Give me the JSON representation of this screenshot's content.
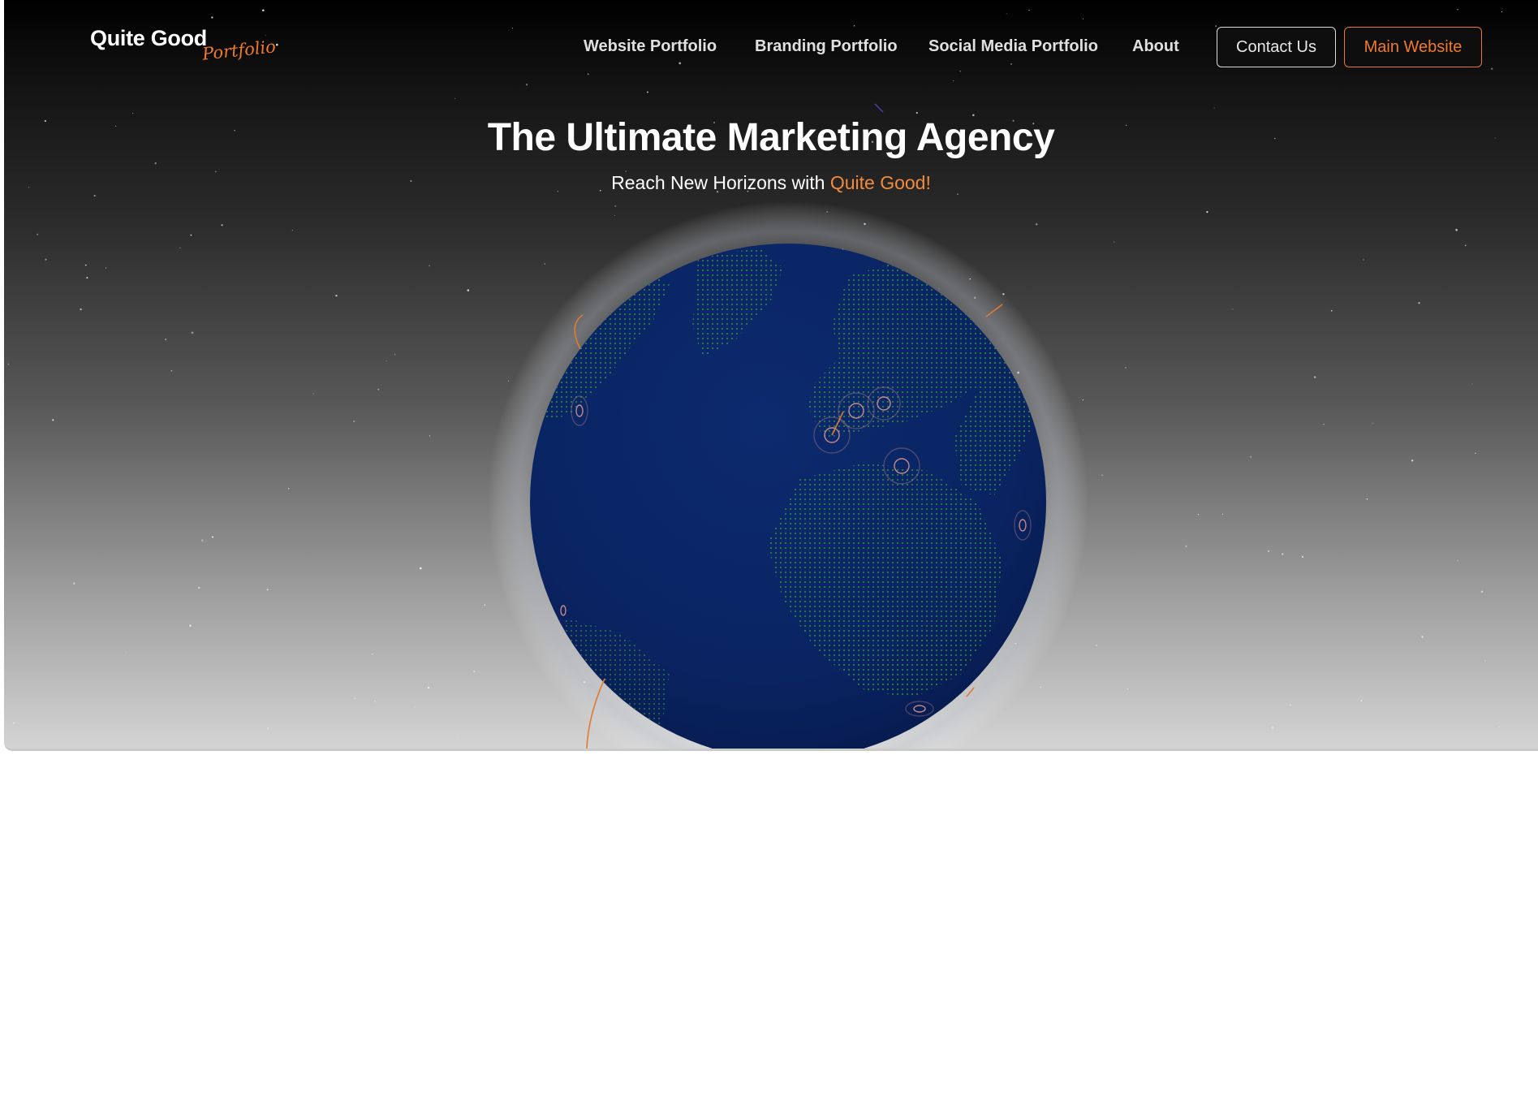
{
  "brand": {
    "name": "Quite Good",
    "tagline": "Portfolio",
    "accent_color": "#f07a2a"
  },
  "nav": {
    "links": [
      {
        "label": "Website Portfolio"
      },
      {
        "label": "Branding Portfolio"
      },
      {
        "label": "Social Media Portfolio"
      },
      {
        "label": "About"
      }
    ],
    "contact_label": "Contact Us",
    "main_website_label": "Main Website"
  },
  "hero": {
    "title": "The Ultimate Marketing Agency",
    "subtitle_prefix": "Reach New Horizons with ",
    "subtitle_accent": "Quite Good!",
    "globe_color": "#0a2564",
    "land_dot_color": "#2e8b3a",
    "arc_color": "#e07a32"
  }
}
